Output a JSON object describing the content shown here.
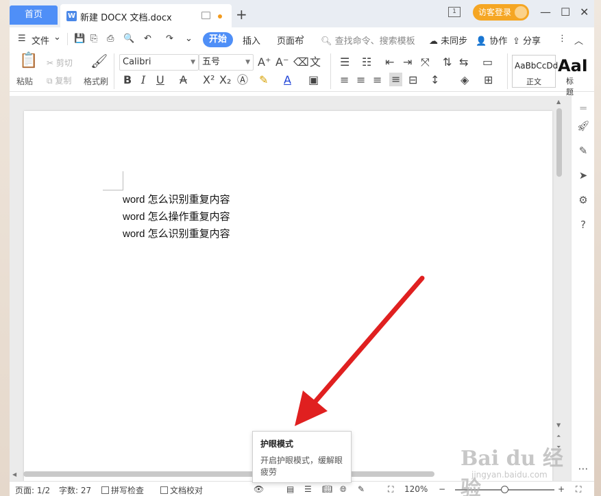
{
  "titlebar": {
    "home_tab": "首页",
    "doc_tab_icon": "W",
    "doc_tab_title": "新建 DOCX 文档.docx",
    "new_tab": "+",
    "layout_badge": "1",
    "login": "访客登录",
    "window_controls": [
      "—",
      "☐",
      "✕"
    ]
  },
  "menu": {
    "file": "文件",
    "file_arrow": "⌄",
    "items": [
      "开始",
      "插入",
      "页面布"
    ],
    "more": "›",
    "search_placeholder": "查找命令、搜索模板",
    "sync": "未同步",
    "collab": "协作",
    "share": "分享",
    "more_menu": "⋮",
    "collapse": "︿"
  },
  "ribbon": {
    "paste": "粘贴",
    "cut": "剪切",
    "copy": "复制",
    "format_painter": "格式刷",
    "font_name": "Calibri",
    "font_size": "五号",
    "style_normal_sample": "AaBbCcDd",
    "style_normal": "正文",
    "style_heading_sample": "AaI",
    "style_heading": "标题"
  },
  "document": {
    "lines": [
      "word 怎么识别重复内容",
      "word 怎么操作重复内容",
      "word 怎么识别重复内容"
    ]
  },
  "tooltip": {
    "title": "护眼模式",
    "body": "开启护眼模式，缓解眼疲劳"
  },
  "statusbar": {
    "page": "页面: 1/2",
    "words": "字数: 27",
    "spell_check": "拼写检查",
    "proofread": "文档校对",
    "zoom": "120%",
    "zoom_minus": "−",
    "zoom_plus": "+"
  },
  "watermark": {
    "brand": "Bai du 经验",
    "url": "jingyan.baidu.com"
  },
  "colors": {
    "accent": "#4f8ff7",
    "login": "#f5a623",
    "arrow": "#e02020"
  }
}
